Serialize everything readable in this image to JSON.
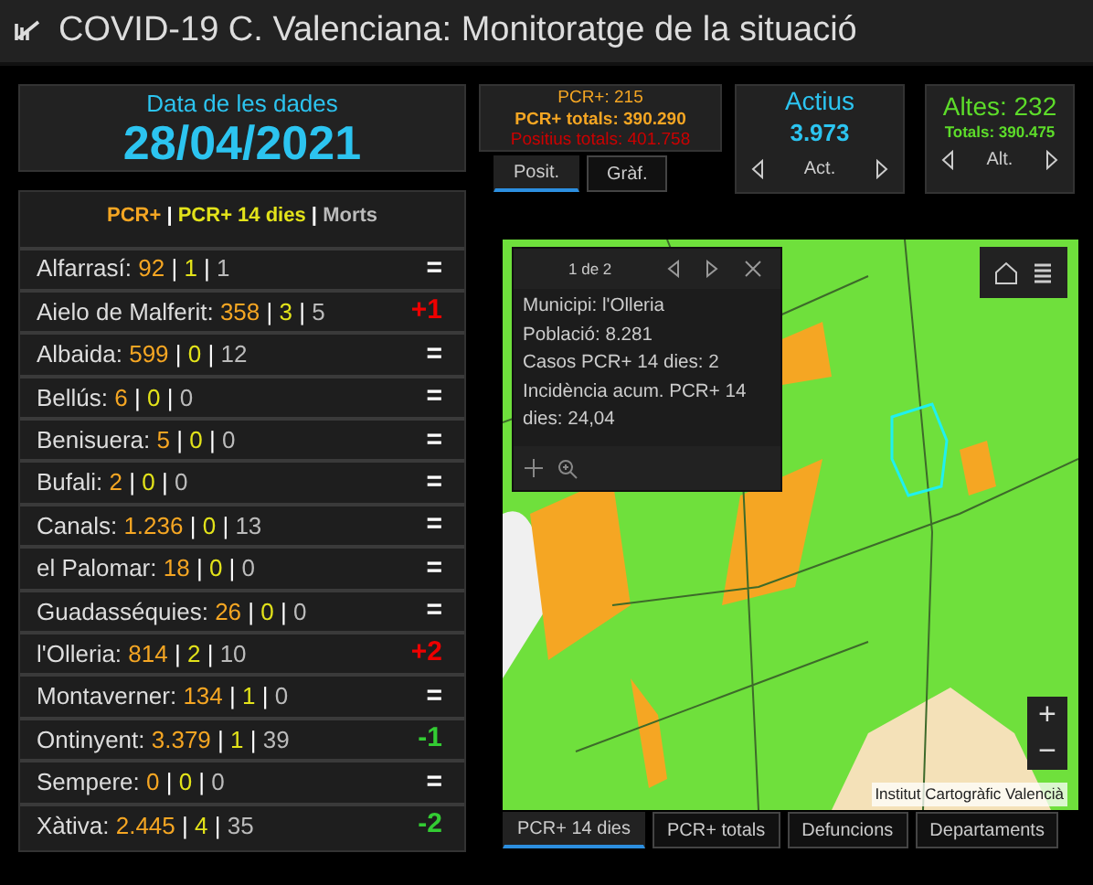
{
  "header": {
    "title": "COVID-19 C. Valenciana: Monitoratge de la situació"
  },
  "date_card": {
    "label": "Data de les dades",
    "value": "28/04/2021"
  },
  "pcr_card": {
    "lines": [
      {
        "kind": "pcr",
        "text": "PCR+: 215"
      },
      {
        "kind": "total",
        "text": "PCR+ totals: 390.290"
      },
      {
        "kind": "positive",
        "text": "Positius totals: 401.758"
      }
    ],
    "tabs": [
      {
        "label": "Posit.",
        "selected": true
      },
      {
        "label": "Gràf.",
        "selected": false
      }
    ]
  },
  "active_card": {
    "title": "Actius",
    "value": "3.973",
    "nav": "Act."
  },
  "discharge_card": {
    "title": "Altes: 232",
    "value": "Totals: 390.475",
    "nav": "Alt."
  },
  "list": {
    "separator": "|",
    "legend": [
      {
        "kind": "pcr",
        "text": "PCR+"
      },
      {
        "kind": "pcr14",
        "text": "PCR+ 14 dies"
      },
      {
        "kind": "deaths",
        "text": "Morts"
      }
    ],
    "rows": [
      {
        "name": "Alfarrasí:",
        "pcr": "92",
        "pcr14": "1",
        "deaths": "1",
        "trend": "=",
        "kind": "same"
      },
      {
        "name": "Aielo de Malferit:",
        "pcr": "358",
        "pcr14": "3",
        "deaths": "5",
        "trend": "+1",
        "kind": "up"
      },
      {
        "name": "Albaida:",
        "pcr": "599",
        "pcr14": "0",
        "deaths": "12",
        "trend": "=",
        "kind": "same"
      },
      {
        "name": "Bellús:",
        "pcr": "6",
        "pcr14": "0",
        "deaths": "0",
        "trend": "=",
        "kind": "same"
      },
      {
        "name": "Benisuera:",
        "pcr": "5",
        "pcr14": "0",
        "deaths": "0",
        "trend": "=",
        "kind": "same"
      },
      {
        "name": "Bufali:",
        "pcr": "2",
        "pcr14": "0",
        "deaths": "0",
        "trend": "=",
        "kind": "same"
      },
      {
        "name": "Canals:",
        "pcr": "1.236",
        "pcr14": "0",
        "deaths": "13",
        "trend": "=",
        "kind": "same"
      },
      {
        "name": "el Palomar:",
        "pcr": "18",
        "pcr14": "0",
        "deaths": "0",
        "trend": "=",
        "kind": "same"
      },
      {
        "name": "Guadasséquies:",
        "pcr": "26",
        "pcr14": "0",
        "deaths": "0",
        "trend": "=",
        "kind": "same"
      },
      {
        "name": "l'Olleria:",
        "pcr": "814",
        "pcr14": "2",
        "deaths": "10",
        "trend": "+2",
        "kind": "up"
      },
      {
        "name": "Montaverner:",
        "pcr": "134",
        "pcr14": "1",
        "deaths": "0",
        "trend": "=",
        "kind": "same"
      },
      {
        "name": "Ontinyent:",
        "pcr": "3.379",
        "pcr14": "1",
        "deaths": "39",
        "trend": "-1",
        "kind": "down"
      },
      {
        "name": "Sempere:",
        "pcr": "0",
        "pcr14": "0",
        "deaths": "0",
        "trend": "=",
        "kind": "same"
      },
      {
        "name": "Xàtiva:",
        "pcr": "2.445",
        "pcr14": "4",
        "deaths": "35",
        "trend": "-2",
        "kind": "down"
      }
    ]
  },
  "map": {
    "popup": {
      "pager": "1 de 2",
      "lines": [
        "Municipi: l'Olleria",
        "Població: 8.281",
        "Casos PCR+ 14 dies: 2",
        "Incidència acum. PCR+ 14 dies: 24,04"
      ]
    },
    "zoom_in": "+",
    "zoom_out": "−",
    "attribution": "Institut Cartogràfic Valencià"
  },
  "map_tabs": [
    {
      "label": "PCR+ 14 dies",
      "selected": true
    },
    {
      "label": "PCR+ totals",
      "selected": false
    },
    {
      "label": "Defuncions",
      "selected": false
    },
    {
      "label": "Departaments",
      "selected": false
    }
  ]
}
